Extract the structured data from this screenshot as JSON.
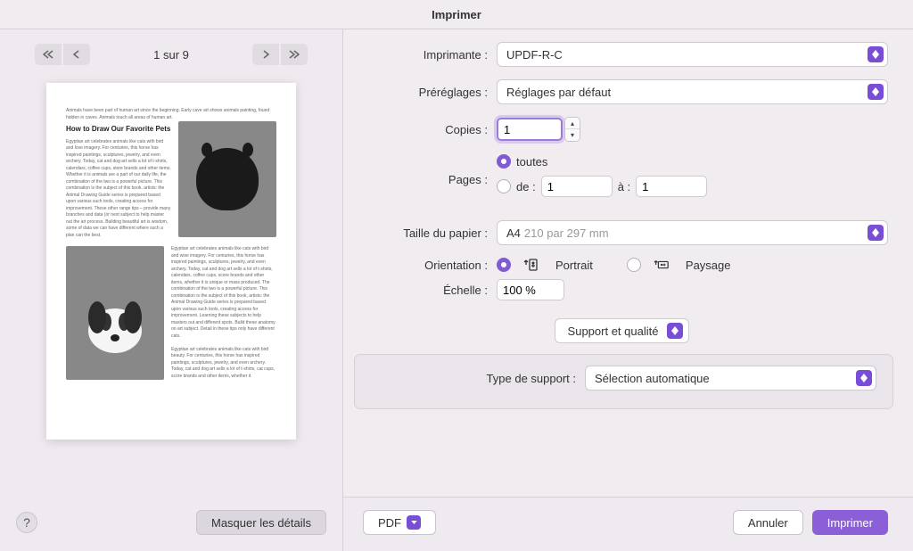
{
  "window": {
    "title": "Imprimer"
  },
  "sidebar": {
    "page_indicator": "1 sur 9",
    "preview_heading": "How to Draw Our Favorite Pets"
  },
  "labels": {
    "printer": "Imprimante :",
    "presets": "Préréglages :",
    "copies": "Copies :",
    "pages": "Pages :",
    "pages_all": "toutes",
    "pages_from": "de :",
    "pages_to": "à :",
    "paper_size": "Taille du papier :",
    "orientation": "Orientation :",
    "portrait": "Portrait",
    "landscape": "Paysage",
    "scale": "Échelle :",
    "section": "Support et qualité",
    "media_type": "Type de support :"
  },
  "values": {
    "printer": "UPDF-R-C",
    "presets": "Réglages par défaut",
    "copies": "1",
    "pages_from": "1",
    "pages_to": "1",
    "paper_size": "A4",
    "paper_size_hint": "210 par 297 mm",
    "scale": "100 %",
    "media_type": "Sélection automatique"
  },
  "footer": {
    "help": "?",
    "hide_details": "Masquer les détails",
    "pdf": "PDF",
    "cancel": "Annuler",
    "print": "Imprimer"
  }
}
